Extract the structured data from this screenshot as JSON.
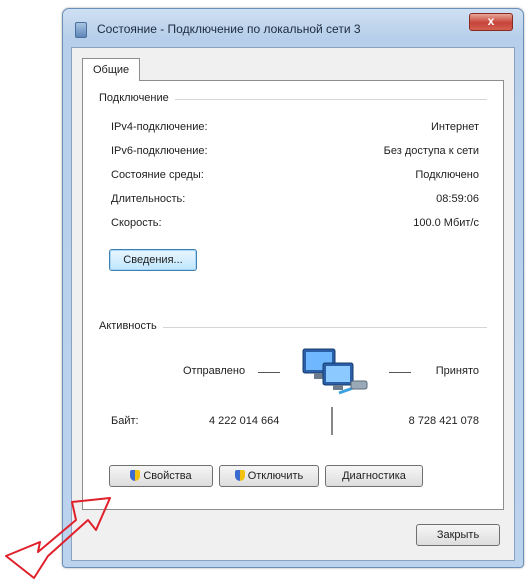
{
  "window": {
    "title": "Состояние - Подключение по локальной сети 3",
    "close_label": "x"
  },
  "tabs": [
    {
      "label": "Общие",
      "active": true
    }
  ],
  "connection": {
    "group_label": "Подключение",
    "rows": [
      {
        "label": "IPv4-подключение:",
        "value": "Интернет"
      },
      {
        "label": "IPv6-подключение:",
        "value": "Без доступа к сети"
      },
      {
        "label": "Состояние среды:",
        "value": "Подключено"
      },
      {
        "label": "Длительность:",
        "value": "08:59:06"
      },
      {
        "label": "Скорость:",
        "value": "100.0 Мбит/с"
      }
    ],
    "details_button": "Сведения..."
  },
  "activity": {
    "group_label": "Активность",
    "sent_label": "Отправлено",
    "received_label": "Принято",
    "bytes_label": "Байт:",
    "bytes_sent": "4 222 014 664",
    "bytes_received": "8 728 421 078",
    "icon": "network-computers-icon"
  },
  "buttons": {
    "properties": "Свойства",
    "disable": "Отключить",
    "diagnose": "Диагностика",
    "close": "Закрыть"
  },
  "colors": {
    "frame": "#bcd3ee",
    "close_button": "#c7443a",
    "annotation_arrow": "#e0212b"
  }
}
